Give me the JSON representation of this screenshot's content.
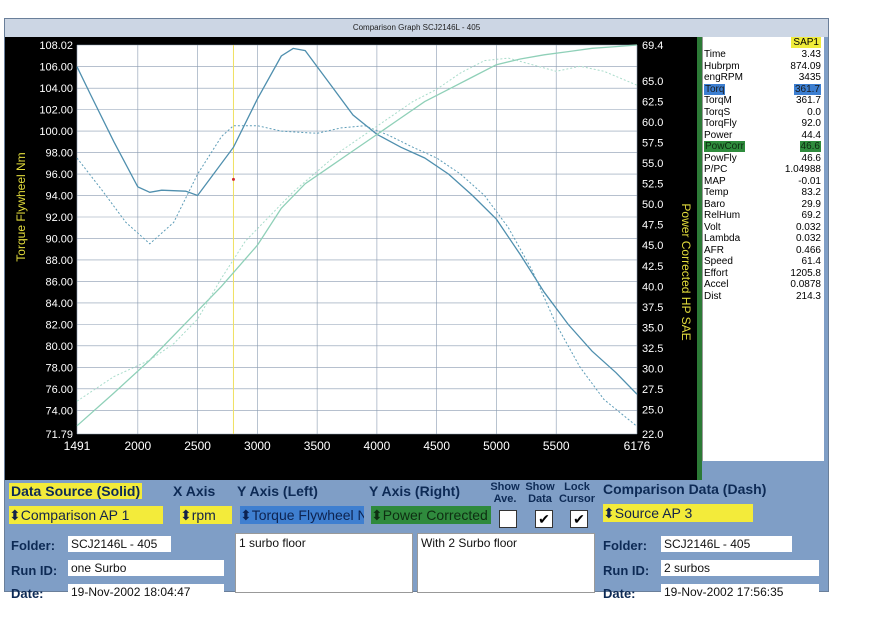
{
  "window": {
    "title": "Comparison Graph  SCJ2146L - 405"
  },
  "chart_data": {
    "type": "line",
    "x_label_ticks": [
      "1491",
      "2000",
      "2500",
      "3000",
      "3500",
      "4000",
      "4500",
      "5000",
      "5500",
      "6176"
    ],
    "x_tick_values": [
      1491,
      2000,
      2500,
      3000,
      3500,
      4000,
      4500,
      5000,
      5500,
      6176
    ],
    "xlim": [
      1491,
      6176
    ],
    "ylabel_left": "Torque Flywheel Nm",
    "ylabel_right": "Power Corrected HP SAE",
    "ylim_left": [
      71.79,
      108.02
    ],
    "ylim_right": [
      22.0,
      69.4
    ],
    "left_ticks": [
      "108.02",
      "106.00",
      "104.00",
      "102.00",
      "100.00",
      "98.00",
      "96.00",
      "94.00",
      "92.00",
      "90.00",
      "88.00",
      "86.00",
      "84.00",
      "82.00",
      "80.00",
      "78.00",
      "76.00",
      "74.00",
      "71.79"
    ],
    "left_tick_values": [
      108.02,
      106,
      104,
      102,
      100,
      98,
      96,
      94,
      92,
      90,
      88,
      86,
      84,
      82,
      80,
      78,
      76,
      74,
      71.79
    ],
    "right_ticks": [
      "69.4",
      "65.0",
      "62.5",
      "60.0",
      "57.5",
      "55.0",
      "52.5",
      "50.0",
      "47.5",
      "45.0",
      "42.5",
      "40.0",
      "37.5",
      "35.0",
      "32.5",
      "30.0",
      "27.5",
      "25.0",
      "22.0"
    ],
    "right_tick_values": [
      69.4,
      65,
      62.5,
      60,
      57.5,
      55,
      52.5,
      50,
      47.5,
      45,
      42.5,
      40,
      37.5,
      35,
      32.5,
      30,
      27.5,
      25,
      22
    ],
    "grid": true,
    "cursor_rpm": 2800,
    "series": [
      {
        "axis": "left",
        "style": "solid",
        "color": "#4f8fae",
        "x": [
          1491,
          1600,
          1800,
          2000,
          2100,
          2200,
          2400,
          2500,
          2600,
          2800,
          3000,
          3200,
          3300,
          3400,
          3600,
          3800,
          4000,
          4200,
          4400,
          4600,
          4800,
          5000,
          5200,
          5400,
          5600,
          5800,
          6000,
          6176
        ],
        "y": [
          106.0,
          103.5,
          99.0,
          94.8,
          94.3,
          94.5,
          94.4,
          94.0,
          95.5,
          98.5,
          103.0,
          107.0,
          107.7,
          107.5,
          104.5,
          101.5,
          99.7,
          98.5,
          97.5,
          96.0,
          94.0,
          91.8,
          88.5,
          85.0,
          82.0,
          79.5,
          77.5,
          75.5
        ]
      },
      {
        "axis": "left",
        "style": "dash",
        "color": "#5e9db8",
        "x": [
          1491,
          1700,
          1900,
          2100,
          2300,
          2500,
          2700,
          2800,
          3000,
          3200,
          3500,
          3700,
          3900,
          4100,
          4300,
          4500,
          4700,
          4900,
          5100,
          5300,
          5500,
          5700,
          5900,
          6176
        ],
        "y": [
          97.5,
          94.5,
          91.5,
          89.5,
          91.5,
          96.0,
          99.5,
          100.5,
          100.5,
          100.0,
          99.8,
          100.3,
          100.5,
          99.6,
          98.5,
          97.5,
          96.0,
          94.0,
          91.0,
          87.0,
          82.0,
          78.0,
          75.0,
          72.5
        ]
      },
      {
        "axis": "right",
        "style": "solid",
        "color": "#8fd0b8",
        "x": [
          1491,
          1800,
          2100,
          2400,
          2700,
          3000,
          3200,
          3400,
          3600,
          3800,
          4000,
          4200,
          4400,
          4600,
          4800,
          5000,
          5200,
          5400,
          5600,
          5800,
          6000,
          6176
        ],
        "y": [
          23.0,
          27.0,
          31.0,
          35.5,
          40.0,
          45.0,
          49.5,
          52.5,
          54.5,
          56.5,
          58.5,
          60.5,
          62.5,
          64.0,
          65.5,
          67.0,
          67.7,
          68.2,
          68.6,
          69.0,
          69.2,
          69.4
        ]
      },
      {
        "axis": "right",
        "style": "dash",
        "color": "#a9dccb",
        "x": [
          1491,
          1800,
          2100,
          2300,
          2500,
          2700,
          2900,
          3100,
          3300,
          3500,
          3700,
          3900,
          4100,
          4300,
          4500,
          4700,
          4900,
          5100,
          5300,
          5500,
          5700,
          5900,
          6176
        ],
        "y": [
          26.0,
          29.0,
          31.0,
          33.0,
          36.0,
          41.0,
          45.5,
          48.5,
          51.5,
          54.0,
          56.5,
          58.5,
          60.5,
          62.5,
          64.0,
          66.0,
          67.5,
          67.8,
          67.0,
          66.2,
          66.8,
          66.2,
          64.5
        ]
      }
    ]
  },
  "readout": {
    "header": "SAP1",
    "rows": [
      {
        "label": "Time",
        "value": "3.43",
        "hl": ""
      },
      {
        "label": "Hubrpm",
        "value": "874.09",
        "hl": ""
      },
      {
        "label": "engRPM",
        "value": "3435",
        "hl": ""
      },
      {
        "label": "Torq",
        "value": "361.7",
        "hl": "blue"
      },
      {
        "label": "TorqM",
        "value": "361.7",
        "hl": ""
      },
      {
        "label": "TorqS",
        "value": "0.0",
        "hl": ""
      },
      {
        "label": "TorqFly",
        "value": "92.0",
        "hl": ""
      },
      {
        "label": "Power",
        "value": "44.4",
        "hl": ""
      },
      {
        "label": "PowCorr",
        "value": "46.6",
        "hl": "green"
      },
      {
        "label": "PowFly",
        "value": "46.6",
        "hl": ""
      },
      {
        "label": "P/PC",
        "value": "1.04988",
        "hl": ""
      },
      {
        "label": "MAP",
        "value": "-0.01",
        "hl": ""
      },
      {
        "label": "Temp",
        "value": "83.2",
        "hl": ""
      },
      {
        "label": "Baro",
        "value": "29.9",
        "hl": ""
      },
      {
        "label": "RelHum",
        "value": "69.2",
        "hl": ""
      },
      {
        "label": "Volt",
        "value": "0.032",
        "hl": ""
      },
      {
        "label": "Lambda",
        "value": "0.032",
        "hl": ""
      },
      {
        "label": "AFR",
        "value": "0.466",
        "hl": ""
      },
      {
        "label": "Speed",
        "value": "61.4",
        "hl": ""
      },
      {
        "label": "Effort",
        "value": "1205.8",
        "hl": ""
      },
      {
        "label": "Accel",
        "value": "0.0878",
        "hl": ""
      },
      {
        "label": "Dist",
        "value": "214.3",
        "hl": ""
      }
    ]
  },
  "controls": {
    "data_source_label": "Data Source (Solid)",
    "x_axis_label": "X Axis",
    "y_left_label": "Y Axis (Left)",
    "y_right_label": "Y Axis (Right)",
    "show_ave_label": "Show Ave.",
    "show_data_label": "Show Data",
    "lock_cursor_label": "Lock Cursor",
    "comparison_label": "Comparison Data (Dash)",
    "data_source_value": "Comparison AP 1",
    "x_axis_value": "rpm",
    "y_left_value": "Torque Flywheel Nm",
    "y_right_value": "Power Corrected HP SAE",
    "comparison_value": "Source AP 3",
    "show_ave_checked": false,
    "show_data_checked": true,
    "lock_cursor_checked": true,
    "check_glyph": "✔",
    "spin_glyph": "⬍"
  },
  "left_info": {
    "folder_label": "Folder:",
    "folder_value": "SCJ2146L - 405",
    "runid_label": "Run ID:",
    "runid_value": "one Surbo",
    "date_label": "Date:",
    "date_value": "19-Nov-2002  18:04:47",
    "notes": "1 surbo floor"
  },
  "right_info": {
    "folder_label": "Folder:",
    "folder_value": "SCJ2146L - 405",
    "runid_label": "Run ID:",
    "runid_value": "2 surbos",
    "date_label": "Date:",
    "date_value": "19-Nov-2002  17:56:35",
    "notes": "With 2 Surbo floor"
  }
}
